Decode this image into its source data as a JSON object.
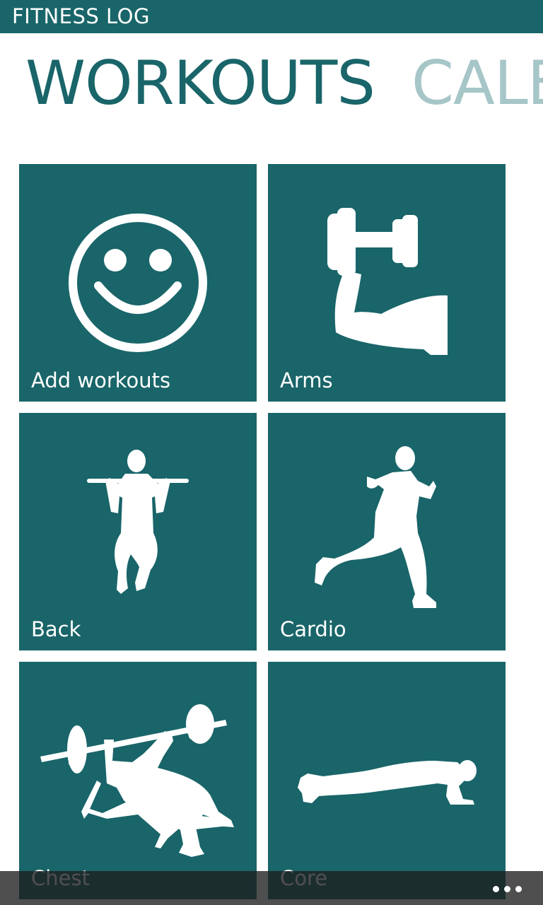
{
  "app": {
    "title": "FITNESS LOG"
  },
  "pivot": {
    "active": "WORKOUTS",
    "next": "CALENDAR"
  },
  "tiles": [
    {
      "label": "Add workouts",
      "icon": "smiley-face-icon"
    },
    {
      "label": "Arms",
      "icon": "dumbbell-curl-icon"
    },
    {
      "label": "Back",
      "icon": "pull-up-icon"
    },
    {
      "label": "Cardio",
      "icon": "running-man-icon"
    },
    {
      "label": "Chest",
      "icon": "bench-press-icon"
    },
    {
      "label": "Core",
      "icon": "plank-icon"
    }
  ],
  "appbar": {
    "more_icon": "ellipsis-icon"
  },
  "colors": {
    "accent": "#196569",
    "pivot_inactive": "#a6c6c8",
    "tile_text": "#ffffff",
    "background": "#ffffff"
  }
}
